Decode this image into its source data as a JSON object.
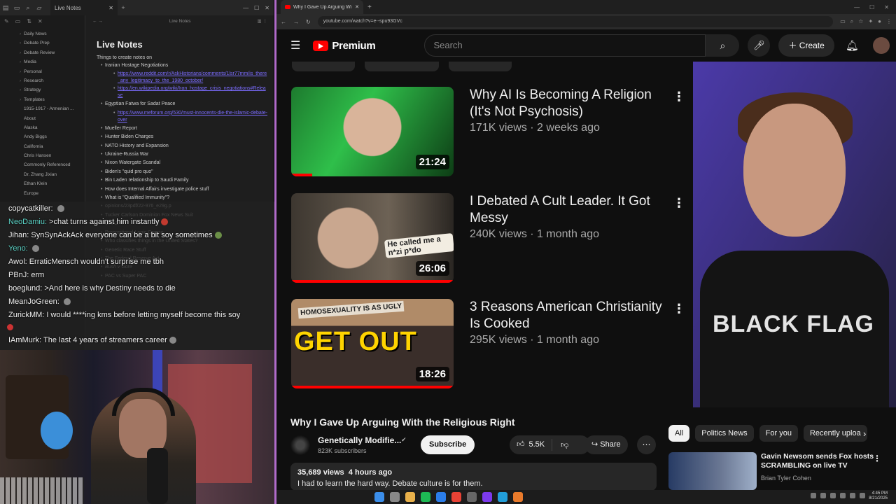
{
  "notes_app": {
    "tab_title": "Live Notes",
    "editor_tab": "Live Notes",
    "sidebar_items": [
      {
        "label": "Daily News",
        "folder": true
      },
      {
        "label": "Debate Prep",
        "folder": true
      },
      {
        "label": "Debate Review",
        "folder": true
      },
      {
        "label": "Media",
        "folder": true
      },
      {
        "label": "Personal",
        "folder": true
      },
      {
        "label": "Research",
        "folder": true
      },
      {
        "label": "Strategy",
        "folder": true
      },
      {
        "label": "Templates",
        "folder": true
      },
      {
        "label": "1915-1917 - Armenian ...",
        "folder": false
      },
      {
        "label": "About",
        "folder": false
      },
      {
        "label": "Alaska",
        "folder": false
      },
      {
        "label": "Andy Biggs",
        "folder": false
      },
      {
        "label": "California",
        "folder": false
      },
      {
        "label": "Chris Hansen",
        "folder": false
      },
      {
        "label": "Commonly Referenced",
        "folder": false
      },
      {
        "label": "Dr. Zhang Jixian",
        "folder": false
      },
      {
        "label": "Ethan Klein",
        "folder": false
      },
      {
        "label": "Europe",
        "folder": false
      }
    ],
    "doc_title": "Live Notes",
    "intro": "Things to create notes on",
    "outline": [
      {
        "text": "Iranian Hostage Negotiations",
        "type": "item"
      },
      {
        "text": "https://www.reddit.com/r/AskHistorians/comments/1lsr77mm/is_there_any_legitimacy_to_the_1980_october/",
        "type": "link"
      },
      {
        "text": "https://en.wikipedia.org/wiki/Iran_hostage_crisis_negotiations#Release",
        "type": "link"
      },
      {
        "text": "Egyptian Fatwa for Sadat Peace",
        "type": "item"
      },
      {
        "text": "https://www.meforum.org/530/must-innocents-die-the-islamic-debate-over",
        "type": "link"
      },
      {
        "text": "Mueller Report",
        "type": "item"
      },
      {
        "text": "Hunter Biden Charges",
        "type": "item"
      },
      {
        "text": "NATO History and Expansion",
        "type": "item"
      },
      {
        "text": "Ukraine-Russia War",
        "type": "item"
      },
      {
        "text": "Nixon Watergate Scandal",
        "type": "item"
      },
      {
        "text": "Biden's \"quid pro quo\"",
        "type": "item"
      },
      {
        "text": "Bin Laden relationship to Saudi Family",
        "type": "item"
      },
      {
        "text": "How does Internal Affairs investigate police stuff",
        "type": "item"
      },
      {
        "text": "What is \"Qualified Immunity\"?",
        "type": "item"
      },
      {
        "text": "opinions/23pdf/22-976_e29g.p",
        "type": "item"
      },
      {
        "text": "Tucker Carlson Dominion Fox News Suit",
        "type": "item"
      },
      {
        "text": "CHAZ",
        "type": "item"
      },
      {
        "text": "",
        "type": "item"
      },
      {
        "text": "Propositional Logic Course",
        "type": "item"
      },
      {
        "text": "Who classifies things in the United States?",
        "type": "item"
      },
      {
        "text": "",
        "type": "item"
      },
      {
        "text": "Genetic Race Stuff",
        "type": "item"
      },
      {
        "text": "The Federal Reserve Act",
        "type": "item"
      },
      {
        "text": "",
        "type": "item"
      },
      {
        "text": "Bush v Gore",
        "type": "ital"
      },
      {
        "text": "PAC vs Super PAC",
        "type": "item"
      }
    ]
  },
  "chat": {
    "messages": [
      {
        "user": "copycatkiller:",
        "text": "",
        "teal": false,
        "emote": "grey"
      },
      {
        "user": "NeoDamiu:",
        "text": ">chat turns against him instantly",
        "teal": true,
        "emote": "red"
      },
      {
        "user": "Jihan:",
        "text": "SynSynAckAck everyone can be a bit soy sometimes",
        "teal": false,
        "emote": "green"
      },
      {
        "user": "Yeno:",
        "text": "",
        "teal": true,
        "emote": "grey"
      },
      {
        "user": "Awol:",
        "text": "ErraticMensch wouldn't surprise me tbh",
        "teal": false,
        "emote": ""
      },
      {
        "user": "PBnJ:",
        "text": "erm",
        "teal": false,
        "emote": ""
      },
      {
        "user": "boeglund:",
        "text": ">And here is why Destiny needs to die",
        "teal": false,
        "emote": ""
      },
      {
        "user": "MeanJoGreen:",
        "text": "",
        "teal": false,
        "emote": "grey"
      },
      {
        "user": "ZurickMM:",
        "text": "I would ****ing kms before letting myself become this soy",
        "teal": false,
        "emote": ""
      },
      {
        "user": "IAmMurk:",
        "text": "The last 4 years of streamers career",
        "teal": false,
        "emote": "grey"
      }
    ]
  },
  "browser": {
    "tab_title": "Why I Gave Up Arguing Wi",
    "url": "youtube.com/watch?v=e--spu93GVc",
    "search_placeholder": "Search",
    "brand": "Premium",
    "create_label": "Create",
    "recommendations": [
      {
        "title": "Why AI Is Becoming A Religion (It's Not Psychosis)",
        "meta": "171K views · 2 weeks ago",
        "duration": "21:24",
        "progress": 0.13
      },
      {
        "title": "I Debated A Cult Leader. It Got Messy",
        "meta": "240K views · 1 month ago",
        "duration": "26:06",
        "progress": 1.0,
        "caption": "He called me a n*zi p*do"
      },
      {
        "title": "3 Reasons American Christianity Is Cooked",
        "meta": "295K views · 1 month ago",
        "duration": "18:26",
        "progress": 1.0,
        "banner": "HOMOSEXUALITY IS AS UGLY",
        "big": "GET OUT"
      }
    ],
    "player_shirt_text": "BLACK FLAG",
    "video": {
      "title": "Why I Gave Up Arguing With the Religious Right",
      "channel": "Genetically Modifie...",
      "subscribers": "823K subscribers",
      "subscribe_label": "Subscribe",
      "likes": "5.5K",
      "share_label": "Share",
      "views": "35,689 views",
      "age": "4 hours ago",
      "description": "I had to learn the hard way. Debate culture is for them."
    },
    "chips": [
      "All",
      "Politics News",
      "For you",
      "Recently uploa"
    ],
    "side_rec": {
      "title": "Gavin Newsom sends Fox hosts SCRAMBLING on live TV",
      "channel": "Brian Tyler Cohen"
    }
  },
  "taskbar": {
    "time": "4:45 PM",
    "date": "8/21/2025"
  }
}
